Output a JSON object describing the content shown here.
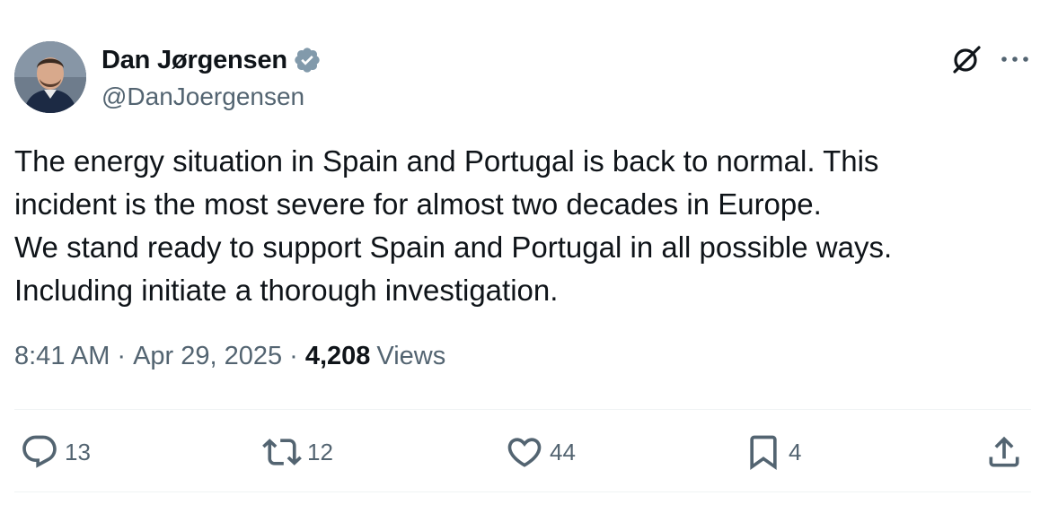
{
  "author": {
    "name": "Dan Jørgensen",
    "handle": "@DanJoergensen"
  },
  "tweet": {
    "lines": [
      "The energy situation in Spain and Portugal is back to normal. This",
      "incident is the most severe for almost two decades in Europe.",
      "We stand ready to support Spain and Portugal in all possible ways.",
      "Including initiate a thorough investigation."
    ],
    "time": "8:41 AM",
    "separator": "·",
    "date": "Apr 29, 2025",
    "views_count": "4,208",
    "views_label": "Views"
  },
  "actions": {
    "replies": "13",
    "reposts": "12",
    "likes": "44",
    "bookmarks": "4"
  },
  "icons": [
    "verified-badge-icon",
    "grok-icon",
    "more-icon",
    "reply-icon",
    "repost-icon",
    "like-icon",
    "bookmark-icon",
    "share-icon"
  ],
  "colors": {
    "text": "#0f1419",
    "secondary": "#536471",
    "verified_badge": "#829aab",
    "divider": "#eff3f4"
  }
}
